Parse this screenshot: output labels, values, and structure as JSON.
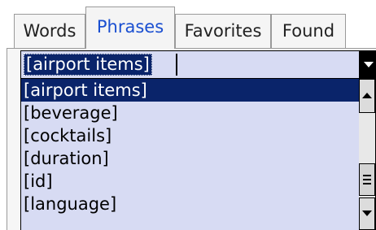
{
  "tabs": [
    {
      "label": "Words"
    },
    {
      "label": "Phrases"
    },
    {
      "label": "Favorites"
    },
    {
      "label": "Found"
    }
  ],
  "active_tab": "Phrases",
  "combo": {
    "value": "[airport items]",
    "icon": "chevron-down-icon"
  },
  "list": {
    "items": [
      {
        "label": "[airport items]"
      },
      {
        "label": "[beverage]"
      },
      {
        "label": "[cocktails]"
      },
      {
        "label": "[duration]"
      },
      {
        "label": "[id]"
      },
      {
        "label": "[language]"
      }
    ],
    "selected_index": 0
  },
  "colors": {
    "selection": "#0a246a",
    "list_background": "#d7dbf3",
    "active_tab_text": "#1a4fd1"
  }
}
